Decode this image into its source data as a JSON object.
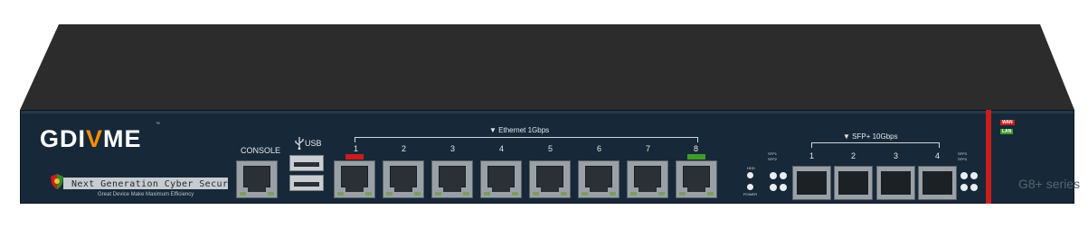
{
  "brand": {
    "logo_part1": "GDI",
    "logo_v": "V",
    "logo_part2": "ME",
    "trademark": "™"
  },
  "tagline": {
    "main": "Next Generation Cyber Security",
    "sub": "Great Device Make Maximum Efficiency"
  },
  "labels": {
    "console": "CONSOLE",
    "usb": "USB",
    "ethernet_header": "▼ Ethernet 1Gbps",
    "sfp_header": "▼ SFP+ 10Gbps",
    "hdd": "HDD",
    "power": "POWER",
    "sfp_1": "SFP1",
    "sfp_2": "SFP2",
    "sfp_3": "SFP3",
    "sfp_4": "SFP4",
    "wan": "WAN",
    "lan": "LAN",
    "series": "G8+ series"
  },
  "ethernet_ports": [
    "1",
    "2",
    "3",
    "4",
    "5",
    "6",
    "7",
    "8"
  ],
  "sfp_ports": [
    "1",
    "2",
    "3",
    "4"
  ],
  "colors": {
    "front_panel": "#172938",
    "top_panel": "#2c2c2c",
    "accent_orange": "#ff8f00",
    "wan": "#c81e1e",
    "lan": "#3f9a2c"
  },
  "icons": {
    "usb_symbol": "usb-icon",
    "shield": "shield-icon"
  }
}
